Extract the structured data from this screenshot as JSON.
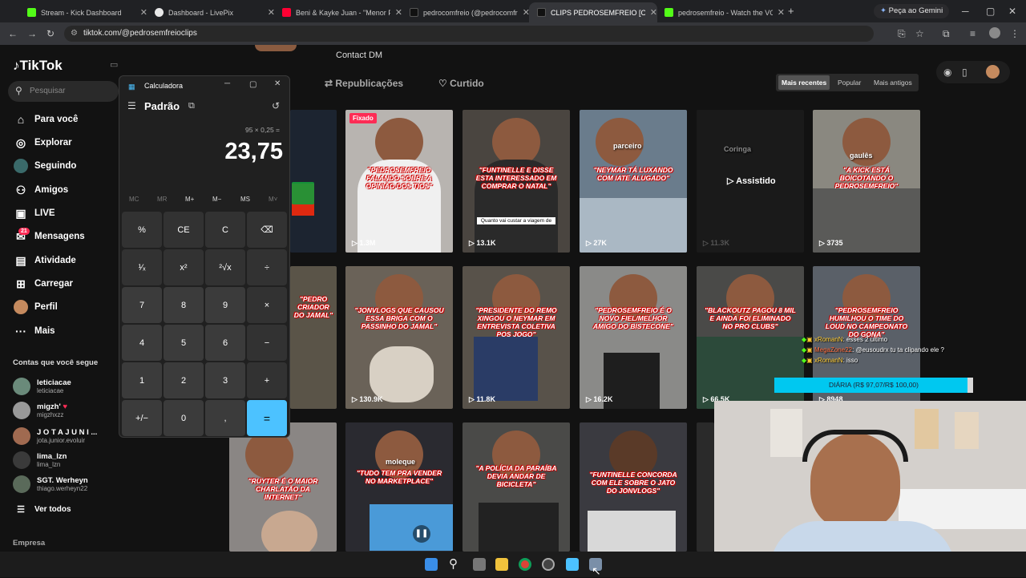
{
  "browser": {
    "tabs": [
      {
        "label": "Stream - Kick Dashboard",
        "color": "#53fc18"
      },
      {
        "label": "Dashboard - LivePix",
        "color": "#e8e8e8"
      },
      {
        "label": "Beni & Kayke Juan - \"Menor Pr",
        "color": "#ff0033"
      },
      {
        "label": "pedrocomfreio (@pedrocomfre",
        "color": "#111111"
      },
      {
        "label": "CLIPS PEDROSEMFREIO [OFICIA",
        "color": "#111111"
      },
      {
        "label": "pedrosemfreio - Watch the VOI",
        "color": "#53fc18"
      }
    ],
    "gemini_label": "Peça ao Gemini",
    "url": "tiktok.com/@pedrosemfreioclips"
  },
  "tiktok": {
    "logo": "TikTok",
    "search_placeholder": "Pesquisar",
    "nav": [
      {
        "label": "Para você",
        "icon": "home-icon"
      },
      {
        "label": "Explorar",
        "icon": "compass-icon"
      },
      {
        "label": "Seguindo",
        "icon": "following-icon"
      },
      {
        "label": "Amigos",
        "icon": "friends-icon"
      },
      {
        "label": "LIVE",
        "icon": "live-icon"
      },
      {
        "label": "Mensagens",
        "icon": "message-icon",
        "badge": "21"
      },
      {
        "label": "Atividade",
        "icon": "activity-icon"
      },
      {
        "label": "Carregar",
        "icon": "upload-icon"
      },
      {
        "label": "Perfil",
        "icon": "profile-icon"
      },
      {
        "label": "Mais",
        "icon": "more-icon"
      }
    ],
    "following_heading": "Contas que você segue",
    "following": [
      {
        "name": "leticiacae",
        "handle": "leticiacae"
      },
      {
        "name": "migzh'",
        "handle": "migzhxzz"
      },
      {
        "name": "J O T A  J U N I ...",
        "handle": "jota.junior.evoluir"
      },
      {
        "name": "lima_lzn",
        "handle": "lima_lzn"
      },
      {
        "name": "SGT. Werheyn",
        "handle": "thiago.werheyn22"
      }
    ],
    "see_all": "Ver todos",
    "company": "Empresa",
    "profile_bio": "Contact DM",
    "tabs": {
      "reposts": "Republicações",
      "liked": "Curtido"
    },
    "sort": {
      "recent": "Mais recentes",
      "popular": "Popular",
      "oldest": "Mais antigos"
    },
    "videos": [
      {
        "caption": "",
        "views": ""
      },
      {
        "caption": "\"PEDROSEMFREIO FALANDO SOBRE A OPINIÃO DOS TIOS\"",
        "views": "1.3M",
        "pinned": "Fixado"
      },
      {
        "caption": "\"FUNTINELLE E DISSE ESTA INTERESSADO EM COMPRAR O NATAL\"",
        "views": "13.1K",
        "sub": "Quanto vai custar a viagem de"
      },
      {
        "caption": "\"NEYMAR TÁ LUXANDO COM IATE ALUGADO\"",
        "views": "27K",
        "tag": "parceiro"
      },
      {
        "caption": "",
        "views": "11.3K",
        "overlay": "Assistido",
        "tag": "Coringa"
      },
      {
        "caption": "\"A KICK ESTÁ BOICOTANDO O PEDROSEMFREIO\"",
        "views": "3735",
        "tag": "gaulês"
      },
      {
        "caption": "\"PEDRO CRIADOR DO JAMAL\"",
        "views": ""
      },
      {
        "caption": "\"JONVLOGS QUE CAUSOU ESSA BRIGA COM O PASSINHO DO JAMAL\"",
        "views": "130.9K"
      },
      {
        "caption": "\"PRESIDENTE DO REMO XINGOU O NEYMAR EM ENTREVISTA COLETIVA POS JOGO\"",
        "views": "11.8K"
      },
      {
        "caption": "\"PEDROSEMFREIO É O NOVO FIEL/MELHOR AMIGO DO BISTECONE\"",
        "views": "16.2K"
      },
      {
        "caption": "\"BLACKOUTZ PAGOU 8 MIL E AINDA FOI ELIMINADO NO PRO CLUBS\"",
        "views": "66.5K"
      },
      {
        "caption": "\"PEDROSEMFREIO HUMILHOU O TIME DO LOUD NO CAMPEONATO DO GONA\"",
        "views": "8948"
      },
      {
        "caption": "\"RUYTER É O MAIOR CHARLATÃO DA INTERNET\"",
        "views": ""
      },
      {
        "caption": "\"TUDO TEM PRA VENDER NO MARKETPLACE\"",
        "views": "",
        "tag": "moleque"
      },
      {
        "caption": "\"A POLÍCIA DA PARAÍBA DEVIA ANDAR DE BICICLETA\"",
        "views": ""
      },
      {
        "caption": "\"FUNTINELLE CONCORDA COM ELE SOBRE O JATO DO JONVLOGS\"",
        "views": ""
      },
      {
        "caption": "",
        "views": ""
      }
    ]
  },
  "calculator": {
    "title": "Calculadora",
    "mode": "Padrão",
    "expression": "95 × 0,25 =",
    "result": "23,75",
    "memory": [
      "MC",
      "MR",
      "M+",
      "M−",
      "MS",
      "M˅"
    ],
    "keys": [
      [
        "%",
        "CE",
        "C",
        "⌫"
      ],
      [
        "¹⁄ₓ",
        "x²",
        "²√x",
        "÷"
      ],
      [
        "7",
        "8",
        "9",
        "×"
      ],
      [
        "4",
        "5",
        "6",
        "−"
      ],
      [
        "1",
        "2",
        "3",
        "+"
      ],
      [
        "+/−",
        "0",
        ",",
        "="
      ]
    ]
  },
  "stream_overlay": {
    "chat": [
      {
        "user": "xRomanN",
        "msg": "esses 2 ultimo"
      },
      {
        "user": "MegaZone22",
        "msg": "@eusoudrx tu ta clipando ele ?"
      },
      {
        "user": "xRomanN",
        "msg": "isso"
      }
    ],
    "goal_label": "DIÁRIA (R$ 97,07/R$ 100,00)",
    "goal_progress": 0.9707,
    "goal_color": "#00c8f0"
  }
}
